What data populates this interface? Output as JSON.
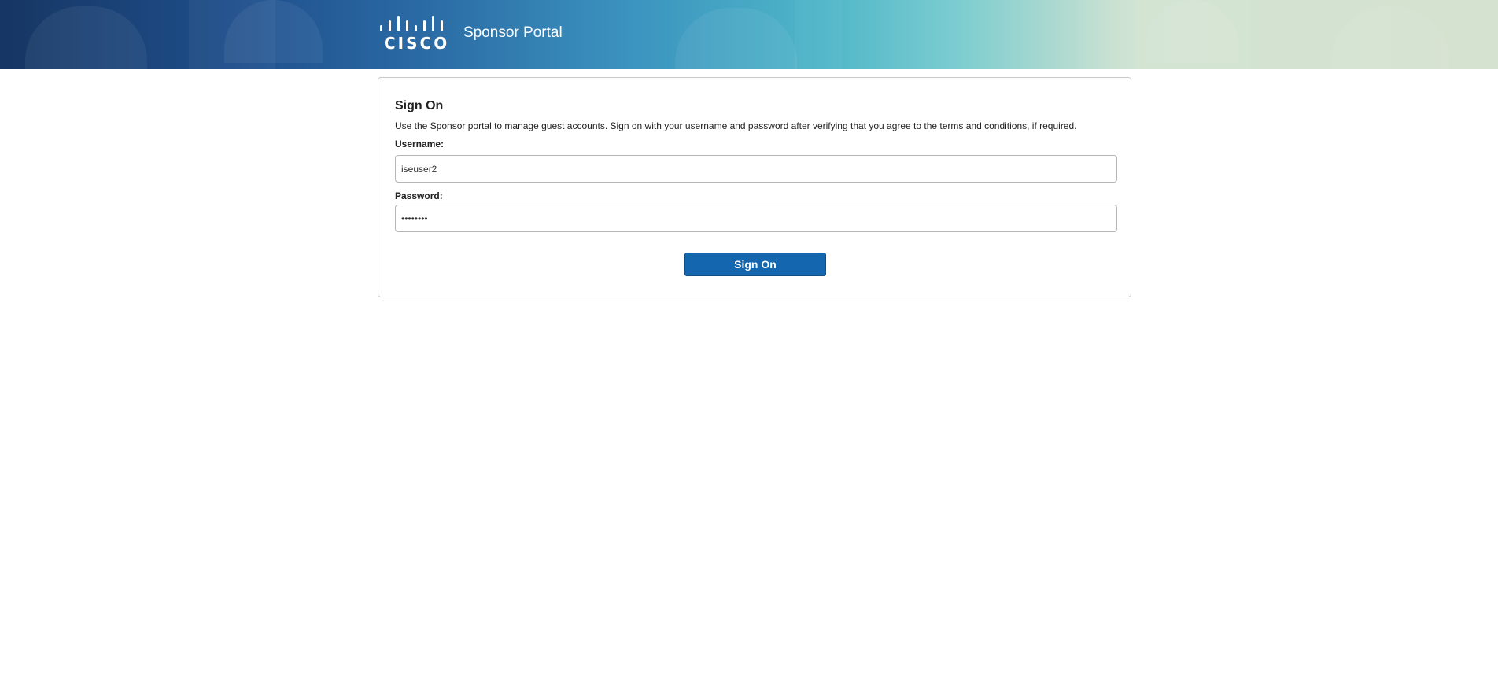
{
  "header": {
    "logo_text": "CISCO",
    "portal_title": "Sponsor Portal"
  },
  "sign_on": {
    "heading": "Sign On",
    "description": "Use the Sponsor portal to manage guest accounts. Sign on with your username and password after verifying that you agree to the terms and conditions, if required.",
    "username_label": "Username:",
    "username_value": "iseuser2",
    "password_label": "Password:",
    "password_value": "********",
    "submit_label": "Sign On"
  },
  "colors": {
    "button": "#1467af",
    "banner_dark": "#163663",
    "banner_teal": "#4fb6c8",
    "banner_light": "#d6e2d0"
  }
}
